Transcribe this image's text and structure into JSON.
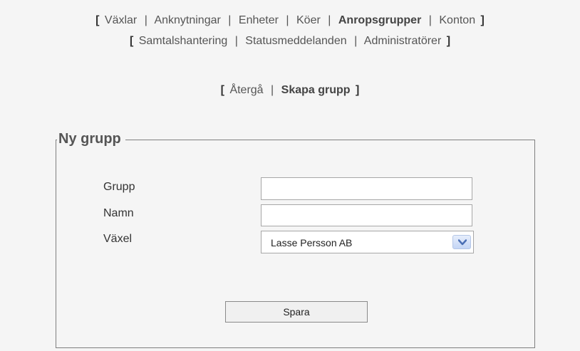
{
  "nav": {
    "row1": {
      "open": "[",
      "items": [
        {
          "label": "Växlar"
        },
        {
          "label": "Anknytningar"
        },
        {
          "label": "Enheter"
        },
        {
          "label": "Köer"
        },
        {
          "label": "Anropsgrupper"
        },
        {
          "label": "Konton"
        }
      ],
      "close": "]"
    },
    "row2": {
      "open": "[",
      "items": [
        {
          "label": "Samtalshantering"
        },
        {
          "label": "Statusmeddelanden"
        },
        {
          "label": "Administratörer"
        }
      ],
      "close": "]"
    },
    "separator": "|",
    "active_item": "Anropsgrupper"
  },
  "subnav": {
    "open": "[",
    "back_label": "Återgå",
    "current_label": "Skapa grupp",
    "close": "]"
  },
  "form": {
    "legend": "Ny grupp",
    "fields": {
      "grupp_label": "Grupp",
      "grupp_value": "",
      "namn_label": "Namn",
      "namn_value": "",
      "vaxel_label": "Växel",
      "vaxel_selected": "Lasse Persson AB"
    },
    "save_label": "Spara"
  },
  "icons": {
    "dropdown": "chevron-down-icon"
  },
  "colors": {
    "background": "#f5f5f5",
    "panel_border": "#7f7f7f",
    "dropdown_arrow": "#4a6fb5"
  }
}
